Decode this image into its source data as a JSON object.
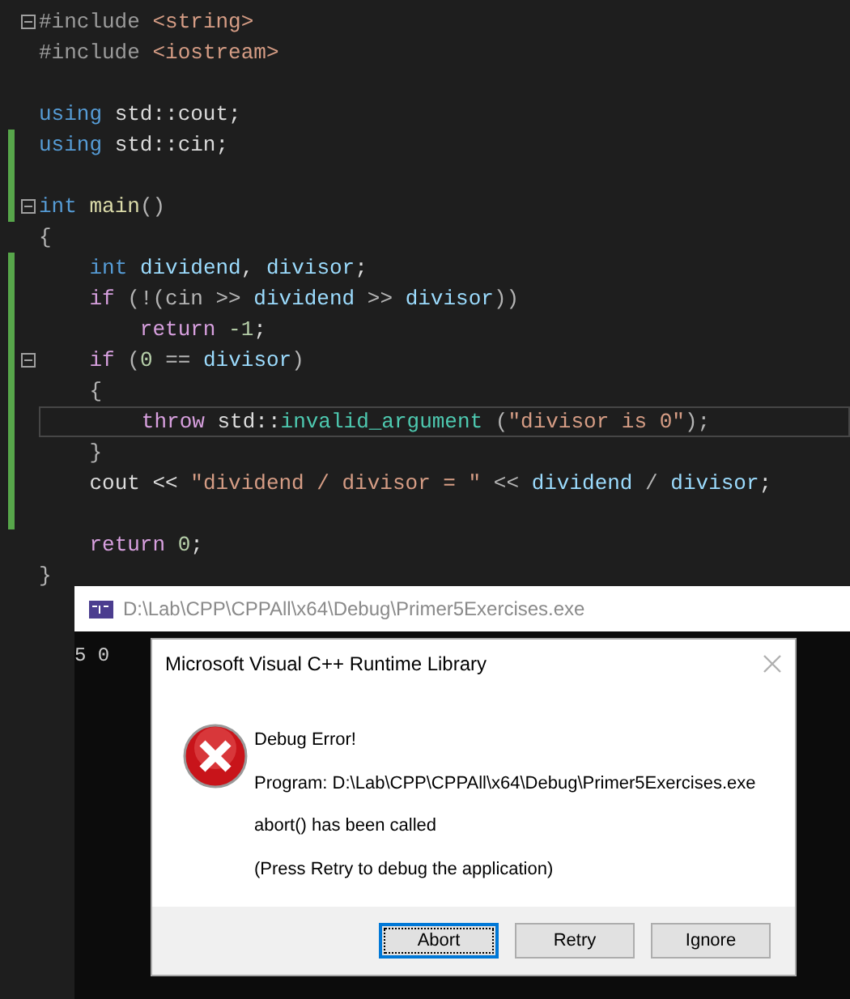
{
  "editor": {
    "lines": [
      {
        "fold": true,
        "changed": false,
        "current": false,
        "tokens": [
          {
            "kind": "pre",
            "text": "#include "
          },
          {
            "kind": "str",
            "text": "<string>"
          }
        ]
      },
      {
        "fold": false,
        "changed": false,
        "current": false,
        "tokens": [
          {
            "kind": "pre",
            "text": "#include "
          },
          {
            "kind": "str",
            "text": "<iostream>"
          }
        ]
      },
      {
        "fold": false,
        "changed": false,
        "current": false
      },
      {
        "fold": false,
        "changed": false,
        "current": false,
        "tokens": [
          {
            "kind": "kw",
            "text": "using "
          },
          {
            "kind": "plain",
            "text": "std::cout;"
          }
        ]
      },
      {
        "fold": false,
        "changed": true,
        "current": false,
        "tokens": [
          {
            "kind": "kw",
            "text": "using "
          },
          {
            "kind": "plain",
            "text": "std::cin;"
          }
        ]
      },
      {
        "fold": false,
        "changed": true,
        "current": false
      },
      {
        "fold": true,
        "changed": true,
        "current": false,
        "tokens": [
          {
            "kind": "kw",
            "text": "int "
          },
          {
            "kind": "fn",
            "text": "main"
          },
          {
            "kind": "punct",
            "text": "()"
          }
        ]
      },
      {
        "fold": false,
        "changed": false,
        "current": false,
        "tokens": [
          {
            "kind": "punct",
            "text": "{"
          }
        ]
      },
      {
        "fold": false,
        "changed": true,
        "current": false,
        "tokens": [
          {
            "kind": "kw",
            "text": "    int "
          },
          {
            "kind": "var",
            "text": "dividend"
          },
          {
            "kind": "plain",
            "text": ", "
          },
          {
            "kind": "var",
            "text": "divisor"
          },
          {
            "kind": "plain",
            "text": ";"
          }
        ]
      },
      {
        "fold": false,
        "changed": true,
        "current": false,
        "tokens": [
          {
            "kind": "ctl",
            "text": "    if "
          },
          {
            "kind": "punct",
            "text": "(!(cin >> "
          },
          {
            "kind": "var",
            "text": "dividend"
          },
          {
            "kind": "punct",
            "text": " >> "
          },
          {
            "kind": "var",
            "text": "divisor"
          },
          {
            "kind": "punct",
            "text": "))"
          }
        ]
      },
      {
        "fold": false,
        "changed": true,
        "current": false,
        "tokens": [
          {
            "kind": "ctl",
            "text": "        return "
          },
          {
            "kind": "num",
            "text": "-1"
          },
          {
            "kind": "plain",
            "text": ";"
          }
        ]
      },
      {
        "fold": true,
        "changed": true,
        "current": false,
        "tokens": [
          {
            "kind": "ctl",
            "text": "    if "
          },
          {
            "kind": "punct",
            "text": "("
          },
          {
            "kind": "num",
            "text": "0"
          },
          {
            "kind": "punct",
            "text": " == "
          },
          {
            "kind": "var",
            "text": "divisor"
          },
          {
            "kind": "punct",
            "text": ")"
          }
        ]
      },
      {
        "fold": false,
        "changed": true,
        "current": false,
        "tokens": [
          {
            "kind": "punct",
            "text": "    {"
          }
        ]
      },
      {
        "fold": false,
        "changed": true,
        "current": true,
        "tokens": [
          {
            "kind": "ctl",
            "text": "        throw "
          },
          {
            "kind": "plain",
            "text": "std::"
          },
          {
            "kind": "type",
            "text": "invalid_argument"
          },
          {
            "kind": "punct",
            "text": " ("
          },
          {
            "kind": "str",
            "text": "\"divisor is 0\""
          },
          {
            "kind": "punct",
            "text": ");"
          }
        ]
      },
      {
        "fold": false,
        "changed": true,
        "current": false,
        "tokens": [
          {
            "kind": "punct",
            "text": "    }"
          }
        ]
      },
      {
        "fold": false,
        "changed": true,
        "current": false,
        "tokens": [
          {
            "kind": "plain",
            "text": "    cout << "
          },
          {
            "kind": "str",
            "text": "\"dividend / divisor = \""
          },
          {
            "kind": "punct",
            "text": " << "
          },
          {
            "kind": "var",
            "text": "dividend"
          },
          {
            "kind": "punct",
            "text": " / "
          },
          {
            "kind": "var",
            "text": "divisor"
          },
          {
            "kind": "plain",
            "text": ";"
          }
        ]
      },
      {
        "fold": false,
        "changed": true,
        "current": false
      },
      {
        "fold": false,
        "changed": false,
        "current": false,
        "tokens": [
          {
            "kind": "ctl",
            "text": "    return "
          },
          {
            "kind": "num",
            "text": "0"
          },
          {
            "kind": "plain",
            "text": ";"
          }
        ]
      },
      {
        "fold": false,
        "changed": false,
        "current": false,
        "tokens": [
          {
            "kind": "punct",
            "text": "}"
          }
        ]
      }
    ]
  },
  "console": {
    "title": "D:\\Lab\\CPP\\CPPAll\\x64\\Debug\\Primer5Exercises.exe",
    "output": "5 0"
  },
  "dialog": {
    "title": "Microsoft Visual C++ Runtime Library",
    "heading": "Debug Error!",
    "messages": [
      "Program: D:\\Lab\\CPP\\CPPAll\\x64\\Debug\\Primer5Exercises.exe",
      "abort() has been called",
      "(Press Retry to debug the application)"
    ],
    "buttons": [
      {
        "label": "Abort",
        "selected": true
      },
      {
        "label": "Retry",
        "selected": false
      },
      {
        "label": "Ignore",
        "selected": false
      }
    ]
  }
}
